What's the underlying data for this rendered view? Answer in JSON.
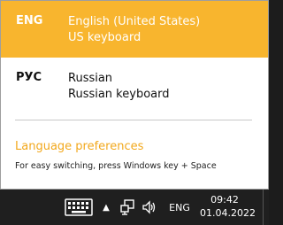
{
  "languages": [
    {
      "code": "ENG",
      "name": "English (United States)",
      "layout": "US keyboard",
      "selected": true
    },
    {
      "code": "РУС",
      "name": "Russian",
      "layout": "Russian keyboard",
      "selected": false
    }
  ],
  "preferences_link": "Language preferences",
  "hint_text": "For easy switching, press Windows key + Space",
  "taskbar": {
    "icons": [
      "keyboard-icon",
      "chevron-up-icon",
      "network-icon",
      "volume-icon"
    ],
    "language_indicator": "ENG",
    "time": "09:42",
    "date": "01.04.2022"
  },
  "colors": {
    "accent": "#f8b52e",
    "link": "#f2a81c",
    "taskbar": "#1f1f1f"
  }
}
